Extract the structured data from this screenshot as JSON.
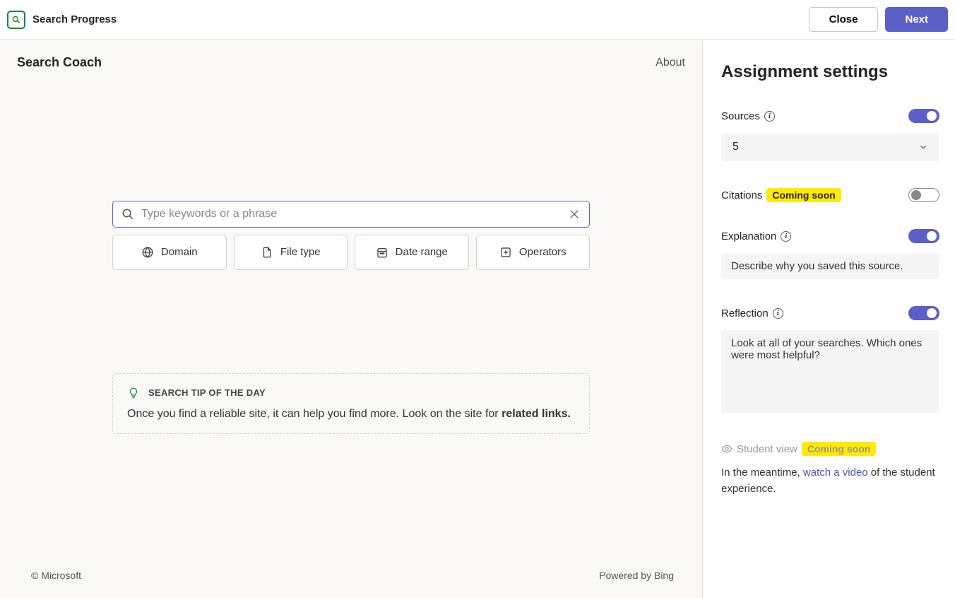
{
  "topbar": {
    "title": "Search Progress",
    "close_label": "Close",
    "next_label": "Next"
  },
  "coach": {
    "title": "Search Coach",
    "about_label": "About"
  },
  "search": {
    "placeholder": "Type keywords or a phrase"
  },
  "filters": {
    "domain": "Domain",
    "file_type": "File type",
    "date_range": "Date range",
    "operators": "Operators"
  },
  "tip": {
    "title": "SEARCH TIP OF THE DAY",
    "body_pre": "Once you find a reliable site, it can help you find more. Look on the site for ",
    "body_bold": "related links."
  },
  "footer": {
    "copyright": "© Microsoft",
    "powered": "Powered by Bing"
  },
  "settings": {
    "title": "Assignment settings",
    "sources": {
      "label": "Sources",
      "value": "5"
    },
    "citations": {
      "label": "Citations",
      "badge": "Coming soon"
    },
    "explanation": {
      "label": "Explanation",
      "text": "Describe why you saved this source."
    },
    "reflection": {
      "label": "Reflection",
      "text": "Look at all of your searches. Which ones were most helpful?"
    },
    "student_view": {
      "label": "Student view",
      "badge": "Coming soon"
    },
    "meantime_pre": "In the meantime, ",
    "meantime_link": "watch a video",
    "meantime_post": " of the student experience."
  }
}
